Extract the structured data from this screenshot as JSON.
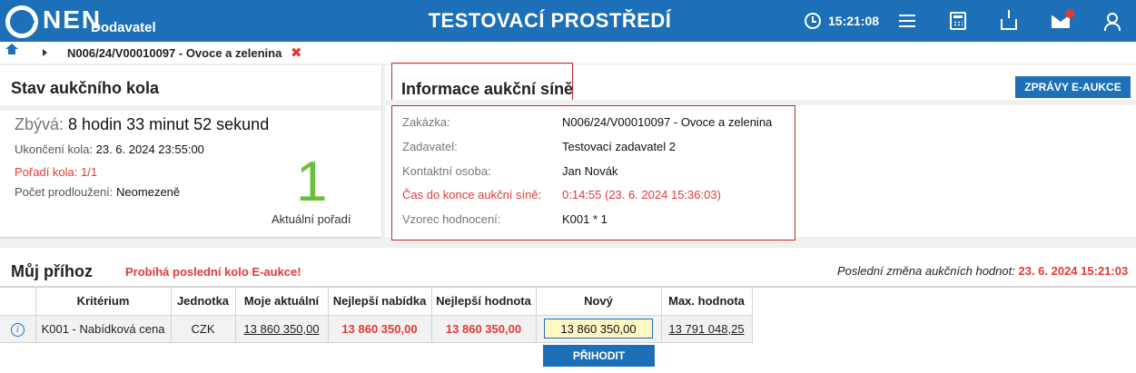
{
  "header": {
    "logo_text": "NEN",
    "logo_sub": "Dodavatel",
    "environment": "TESTOVACÍ PROSTŘEDÍ",
    "clock": "15:21:08",
    "icons": [
      "clock-icon",
      "menu-icon",
      "calculator-icon",
      "inbox-icon",
      "mail-icon",
      "user-icon"
    ],
    "accent_color": "#1d70b7"
  },
  "breadcrumb": {
    "item": "N006/24/V00010097 - Ovoce a zelenina",
    "close_symbol": "✖"
  },
  "round_status": {
    "title": "Stav aukčního kola",
    "remaining_label": "Zbývá:",
    "remaining_value": "8 hodin 33 minut 52 sekund",
    "end_label": "Ukončení kola:",
    "end_value": "23. 6. 2024 23:55:00",
    "round_order": "Pořadí kola: 1/1",
    "extensions_label": "Počet prodloužení:",
    "extensions_value": "Neomezeně",
    "current_rank": "1",
    "current_rank_label": "Aktuální pořadí"
  },
  "auction_info": {
    "title": "Informace aukční síně",
    "messages_button": "ZPRÁVY E-AUKCE",
    "rows": [
      {
        "label": "Zakázka:",
        "value": "N006/24/V00010097 - Ovoce a zelenina"
      },
      {
        "label": "Zadavatel:",
        "value": "Testovací zadavatel 2"
      },
      {
        "label": "Kontaktní osoba:",
        "value": "Jan Novák"
      },
      {
        "label": "Čas do konce aukční síně:",
        "value": "0:14:55 (23. 6. 2024 15:36:03)"
      },
      {
        "label": "Vzorec hodnocení:",
        "value": "K001 * 1"
      }
    ]
  },
  "my_bid": {
    "title": "Můj příhoz",
    "status": "Probíhá poslední kolo E-aukce!",
    "last_change_label": "Poslední změna aukčních hodnot:",
    "last_change_value": "23. 6. 2024 15:21:03",
    "columns": [
      "Kritérium",
      "Jednotka",
      "Moje aktuální",
      "Nejlepší nabídka",
      "Nejlepší hodnota",
      "Nový",
      "Max. hodnota"
    ],
    "row": {
      "criterion": "K001 - Nabídková cena",
      "unit": "CZK",
      "my_current": "13 860 350,00",
      "best_offer": "13 860 350,00",
      "best_value": "13 860 350,00",
      "new_value": "13 860 350,00",
      "max_value": "13 791 048,25"
    },
    "submit_button": "PŘIHODIT"
  }
}
